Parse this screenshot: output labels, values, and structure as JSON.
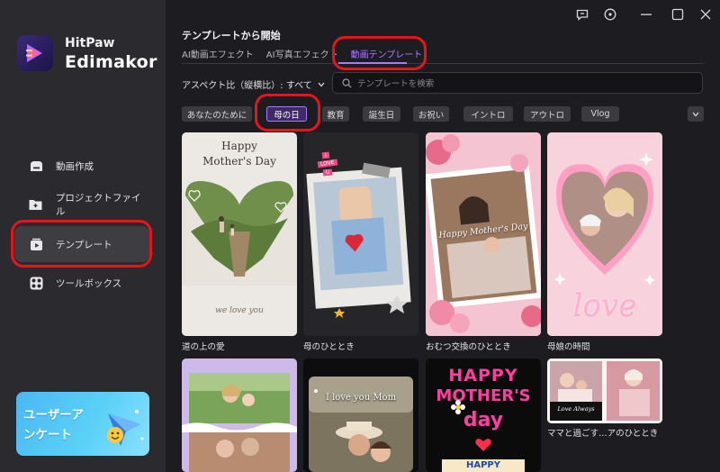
{
  "app": {
    "brand_top": "HitPaw",
    "brand_bottom": "Edimakor"
  },
  "sidebar": {
    "items": [
      {
        "label": "動画作成",
        "icon": "create-video-icon"
      },
      {
        "label": "プロジェクトファイル",
        "icon": "project-folder-icon"
      },
      {
        "label": "テンプレート",
        "icon": "template-icon"
      },
      {
        "label": "ツールボックス",
        "icon": "toolbox-icon"
      }
    ],
    "active_index": 2,
    "promo": {
      "line1": "ユーザーア",
      "line2": "ンケート"
    }
  },
  "window_controls": [
    "feedback-icon",
    "info-icon",
    "minimize-icon",
    "maximize-icon",
    "close-icon"
  ],
  "main": {
    "title": "テンプレートから開始",
    "tabs": [
      "AI動画エフェクト",
      "AI写真エフェクト",
      "動画テンプレート"
    ],
    "active_tab": 2,
    "aspect_label": "アスペクト比（縦横比）: すべて",
    "search_placeholder": "テンプレートを検索",
    "categories": [
      "あなたのために",
      "母の日",
      "教育",
      "誕生日",
      "お祝い",
      "イントロ",
      "アウトロ",
      "Vlog"
    ],
    "active_category": 1
  },
  "cards": [
    {
      "label": "道の上の愛",
      "overlay": [
        "Happy",
        "Mother's Day"
      ],
      "footer": "we love you"
    },
    {
      "label": "母のひととき",
      "overlay": [
        "I",
        "LOVE",
        "U"
      ]
    },
    {
      "label": "おむつ交換のひととき",
      "overlay": [
        "Happy Mother's Day"
      ]
    },
    {
      "label": "母娘の時間",
      "overlay": [
        "love"
      ]
    },
    {
      "label": ""
    },
    {
      "label": "",
      "overlay": [
        "I love you Mom"
      ]
    },
    {
      "label": "",
      "overlay": [
        "HAPPY",
        "MOTHER'S",
        "day",
        "HAPPY"
      ]
    },
    {
      "label": "ママと過ごす…アのひととき",
      "overlay": [
        "Love Always"
      ]
    }
  ],
  "colors": {
    "accent": "#a97bff",
    "highlight_ring": "#e8141d",
    "sidebar_bg": "#2b2b2f",
    "main_bg": "#1d1d21"
  }
}
